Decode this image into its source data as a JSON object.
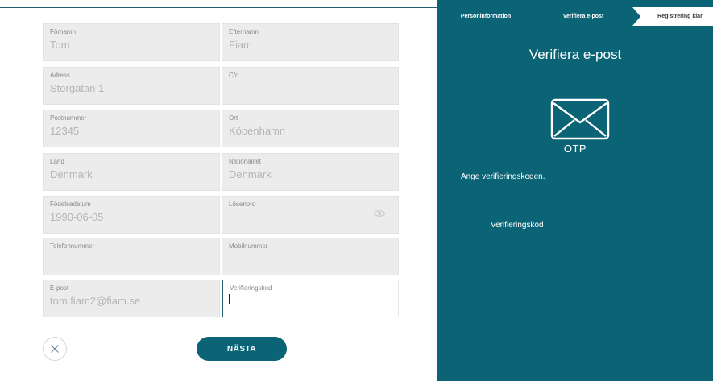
{
  "form": {
    "fields": [
      {
        "label": "Förnamn",
        "value": "Tom"
      },
      {
        "label": "Efternamn",
        "value": "Fiam"
      },
      {
        "label": "Adress",
        "value": "Storgatan 1"
      },
      {
        "label": "C/o",
        "value": ""
      },
      {
        "label": "Postnummer",
        "value": "12345"
      },
      {
        "label": "Ort",
        "value": "Köpenhamn"
      },
      {
        "label": "Land",
        "value": "Denmark"
      },
      {
        "label": "Nationalitet",
        "value": "Denmark"
      },
      {
        "label": "Födelsedatum",
        "value": "1990-06-05"
      },
      {
        "label": "Lösenord",
        "value": ""
      },
      {
        "label": "Telefonnummer",
        "value": ""
      },
      {
        "label": "Mobilnummer",
        "value": ""
      },
      {
        "label": "E-post",
        "value": "tom.fiam2@fiam.se"
      },
      {
        "label": "Verifieringskod",
        "value": ""
      }
    ],
    "next_label": "NÄSTA"
  },
  "panel": {
    "steps": [
      "Personinformation",
      "Verifiera e-post",
      "Registrering klar"
    ],
    "title": "Verifiera e-post",
    "otp_label": "OTP",
    "instruction": "Ange verifieringskoden.",
    "code_label": "Verifieringskod"
  },
  "colors": {
    "brand": "#0b6475",
    "field_bg": "#ececec"
  },
  "icons": {
    "close": "close-icon",
    "eye": "eye-icon",
    "mail": "envelope-icon"
  }
}
